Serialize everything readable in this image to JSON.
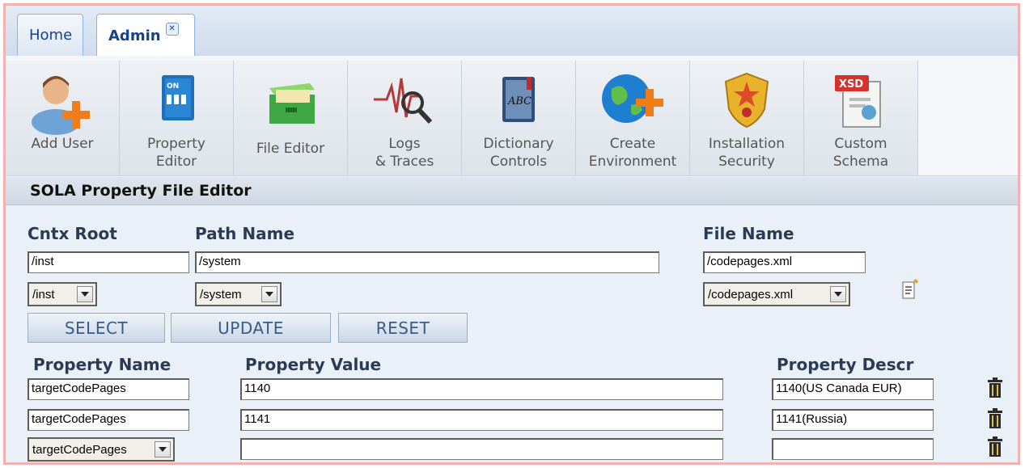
{
  "tabs": [
    {
      "label": "Home",
      "active": false
    },
    {
      "label": "Admin",
      "active": true,
      "close_icon": "close-icon"
    }
  ],
  "toolbar": [
    {
      "label": "Add User",
      "icon": "add-user-icon"
    },
    {
      "label": "Property\nEditor",
      "icon": "property-editor-icon"
    },
    {
      "label": "File Editor",
      "icon": "file-cabinet-icon"
    },
    {
      "label": "Logs\n& Traces",
      "icon": "logs-traces-icon"
    },
    {
      "label": "Dictionary\nControls",
      "icon": "dictionary-icon"
    },
    {
      "label": "Create\nEnvironment",
      "icon": "globe-add-icon"
    },
    {
      "label": "Installation\nSecurity",
      "icon": "security-badge-icon"
    },
    {
      "label": "Custom\nSchema",
      "icon": "xsd-schema-icon"
    }
  ],
  "editor": {
    "title": "SOLA Property File Editor",
    "cntx_root_label": "Cntx Root",
    "path_name_label": "Path Name",
    "file_name_label": "File Name",
    "cntx_root_value": "/inst",
    "path_name_value": "/system",
    "file_name_value": "/codepages.xml",
    "cntx_root_select": "/inst",
    "path_name_select": "/system",
    "file_name_select": "/codepages.xml",
    "select_button": "SELECT",
    "update_button": "UPDATE",
    "reset_button": "RESET",
    "prop_name_label": "Property Name",
    "prop_value_label": "Property Value",
    "prop_descr_label": "Property Descr",
    "rows": [
      {
        "name": "targetCodePages",
        "value": "1140",
        "descr": "1140(US Canada EUR)"
      },
      {
        "name": "targetCodePages",
        "value": "1141",
        "descr": "1141(Russia)"
      },
      {
        "name": "targetCodePages",
        "value": "",
        "descr": ""
      }
    ]
  },
  "colors": {
    "accent": "#15428b",
    "frame_border": "#f3b1b1",
    "toolbar_bg": "#dde3ea"
  }
}
